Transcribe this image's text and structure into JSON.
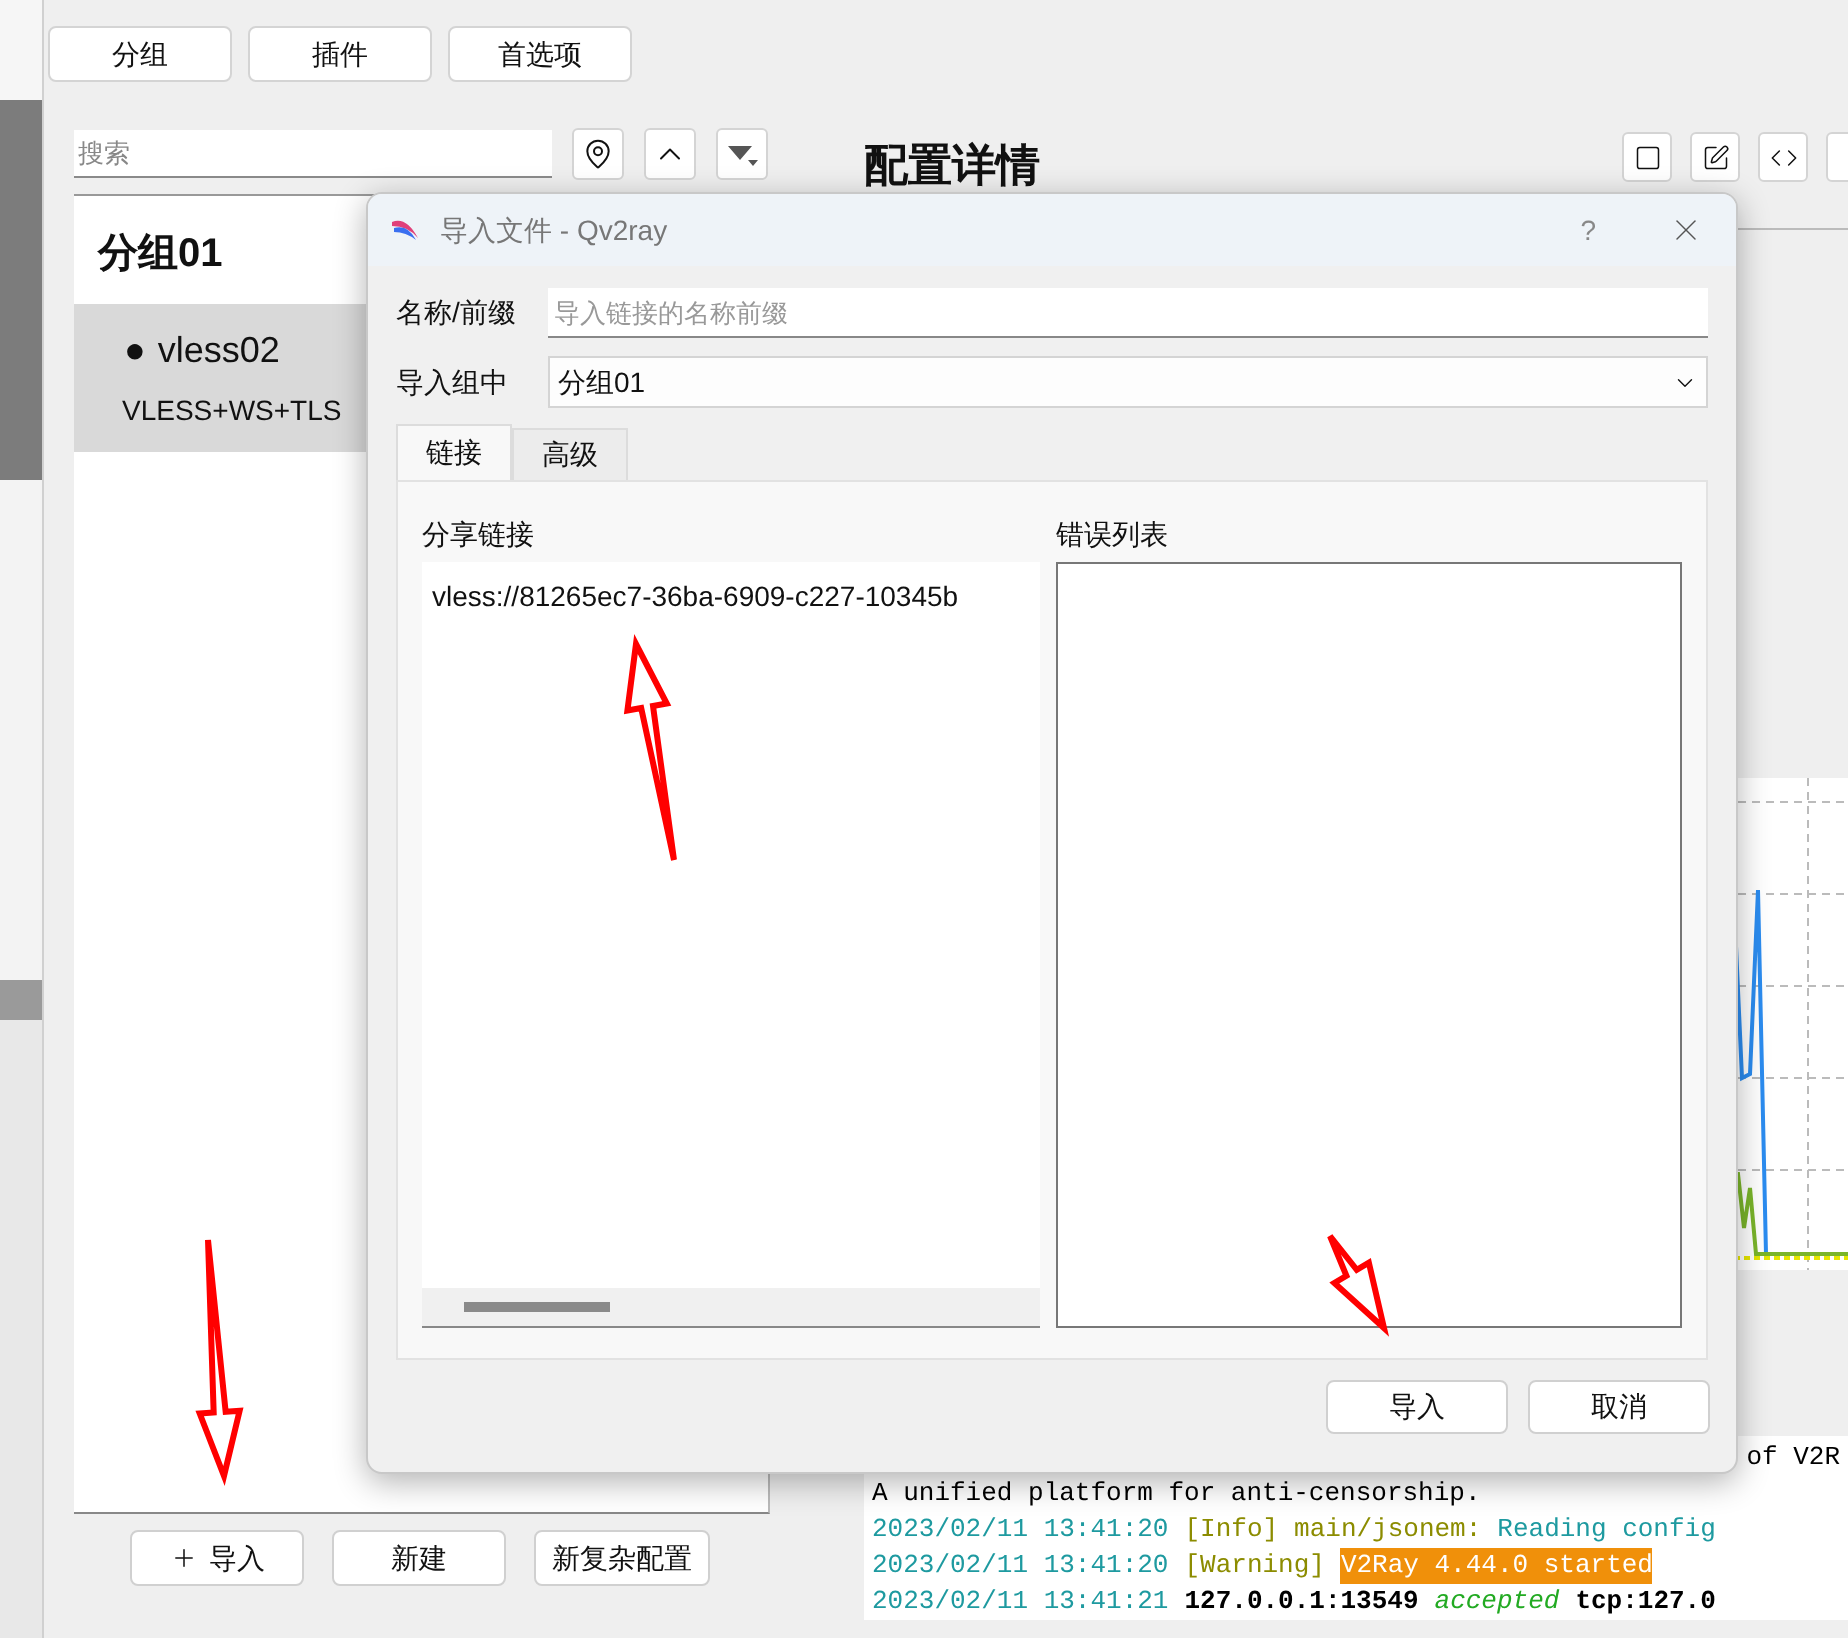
{
  "toolbar": {
    "buttons": [
      "分组",
      "插件",
      "首选项"
    ]
  },
  "search": {
    "placeholder": "搜索"
  },
  "group": {
    "title": "分组01",
    "connections": [
      {
        "bullet": "●",
        "name": "vless02",
        "type": "VLESS+WS+TLS",
        "selected": true
      }
    ]
  },
  "bottom_buttons": [
    {
      "kind": "add",
      "label": "导入"
    },
    {
      "kind": "plain",
      "label": "新建"
    },
    {
      "kind": "plain",
      "label": "新复杂配置"
    }
  ],
  "details": {
    "title": "配置详情"
  },
  "log": {
    "lines": [
      {
        "kind": "overflow",
        "segments": [
          {
            "kind": "text",
            "text": "of V2R"
          }
        ]
      },
      {
        "kind": "plain",
        "segments": [
          {
            "kind": "text",
            "text": "A unified platform for anti-censorship."
          }
        ]
      },
      {
        "kind": "plain",
        "segments": [
          {
            "kind": "time",
            "text": "2023/02/11 13:41:20"
          },
          {
            "kind": "level",
            "text": "[Info]"
          },
          {
            "kind": "level",
            "text": "main/jsonem:"
          },
          {
            "kind": "time",
            "text": "Reading config"
          }
        ]
      },
      {
        "kind": "plain",
        "segments": [
          {
            "kind": "time",
            "text": "2023/02/11 13:41:20"
          },
          {
            "kind": "level",
            "text": "[Warning]"
          },
          {
            "kind": "highlight",
            "text": "V2Ray 4.44.0 started"
          }
        ]
      },
      {
        "kind": "plain",
        "segments": [
          {
            "kind": "time",
            "text": "2023/02/11 13:41:21"
          },
          {
            "kind": "address",
            "text": "127.0.0.1:13549"
          },
          {
            "kind": "status",
            "text": "accepted"
          },
          {
            "kind": "address",
            "text": "tcp:127.0"
          }
        ]
      }
    ]
  },
  "dialog": {
    "title": "导入文件 - Qv2ray",
    "help": "?",
    "name_prefix": {
      "label": "名称/前缀",
      "placeholder": "导入链接的名称前缀"
    },
    "target_group": {
      "label": "导入组中",
      "value": "分组01"
    },
    "tabs": [
      {
        "label": "链接",
        "selected": true
      },
      {
        "label": "高级",
        "selected": false
      }
    ],
    "share_link": {
      "label": "分享链接",
      "value": "vless://81265ec7-36ba-6909-c227-10345b"
    },
    "error_list": {
      "label": "错误列表"
    },
    "buttons": [
      "导入",
      "取消"
    ]
  }
}
